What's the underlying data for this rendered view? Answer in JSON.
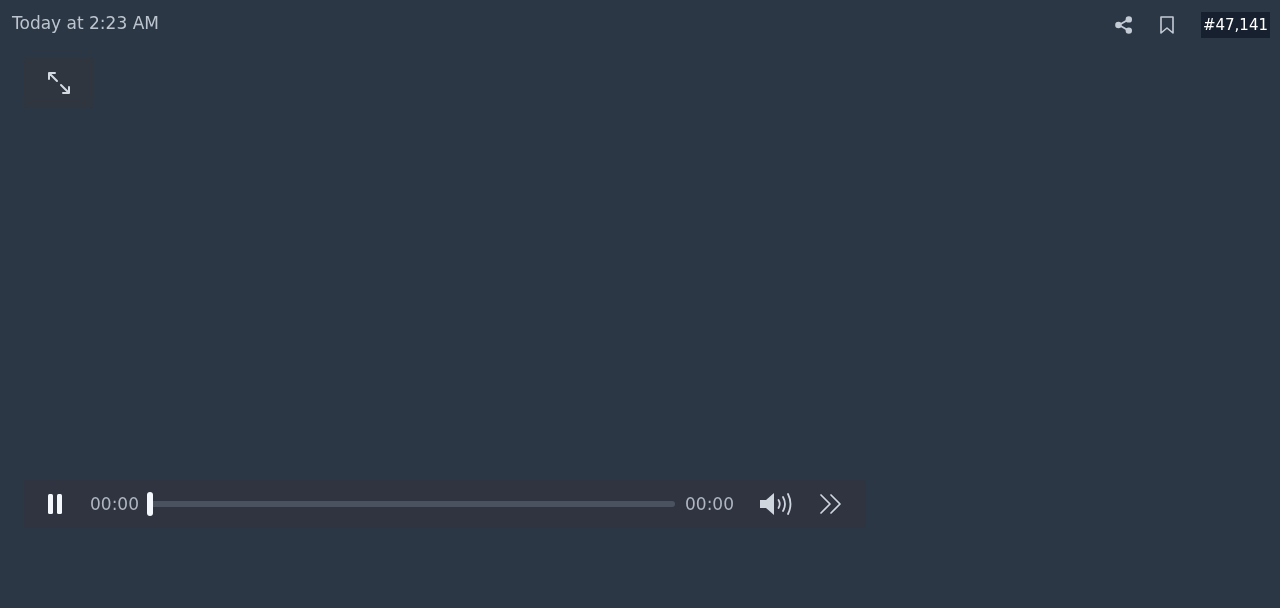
{
  "header": {
    "timestamp": "Today at 2:23 AM",
    "post_number": "#47,141"
  },
  "player": {
    "playing": true,
    "muted": false,
    "elapsed": "00:00",
    "duration": "00:00",
    "progress": {
      "level": 0
    }
  }
}
